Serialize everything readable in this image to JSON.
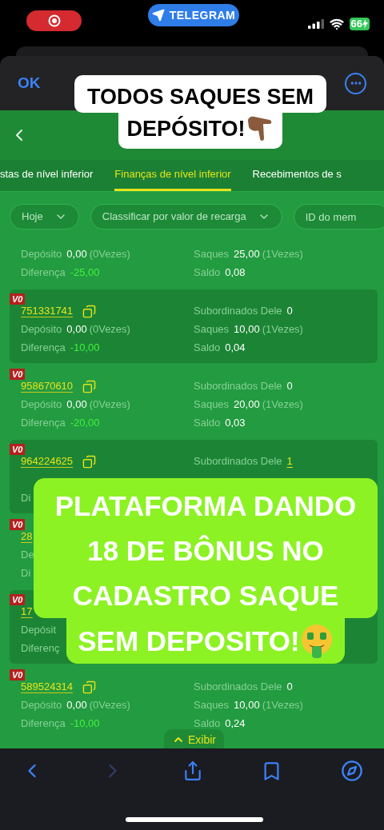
{
  "status_bar": {
    "recording": true,
    "app_pill": "TELEGRAM",
    "battery": "66",
    "charging": true
  },
  "browser": {
    "done": "OK"
  },
  "caption_top": {
    "lines": [
      "TODOS SAQUES SEM",
      "DEPÓSITO!"
    ]
  },
  "tabs": [
    {
      "label": "stas de nível inferior",
      "selected": false
    },
    {
      "label": "Finanças de nível inferior",
      "selected": true
    },
    {
      "label": "Recebimentos de s",
      "selected": false
    }
  ],
  "filters": [
    {
      "kind": "dropdown",
      "label": "Hoje"
    },
    {
      "kind": "dropdown",
      "label": "Classificar por valor de recarga"
    },
    {
      "kind": "field",
      "placeholder": "ID do mem"
    }
  ],
  "rows": [
    {
      "deposit": {
        "label": "Depósito",
        "value": "0,00",
        "count": "(0Vezes)"
      },
      "withdrawals": {
        "label": "Saques",
        "value": "25,00",
        "count": "(1Vezes)"
      },
      "difference": {
        "label": "Diferença",
        "value": "-25,00"
      },
      "balance": {
        "label": "Saldo",
        "value": "0,08"
      }
    },
    {
      "badge": "V0",
      "id": "751331741",
      "copyable": true,
      "subordinates": {
        "label": "Subordinados Dele",
        "value": "0",
        "linked": false
      },
      "deposit": {
        "label": "Depósito",
        "value": "0,00",
        "count": "(0Vezes)"
      },
      "withdrawals": {
        "label": "Saques",
        "value": "10,00",
        "count": "(1Vezes)"
      },
      "difference": {
        "label": "Diferença",
        "value": "-10,00"
      },
      "balance": {
        "label": "Saldo",
        "value": "0,04"
      }
    },
    {
      "badge": "V0",
      "id": "958670610",
      "copyable": true,
      "subordinates": {
        "label": "Subordinados Dele",
        "value": "0",
        "linked": false
      },
      "deposit": {
        "label": "Depósito",
        "value": "0,00",
        "count": "(0Vezes)"
      },
      "withdrawals": {
        "label": "Saques",
        "value": "20,00",
        "count": "(1Vezes)"
      },
      "difference": {
        "label": "Diferença",
        "value": "-20,00"
      },
      "balance": {
        "label": "Saldo",
        "value": "0,03"
      }
    },
    {
      "badge": "V0",
      "id": "964224625",
      "copyable": true,
      "subordinates": {
        "label": "Subordinados Dele",
        "value": "1",
        "linked": true
      },
      "difference": {
        "label": "Di"
      }
    },
    {
      "badge": "V0",
      "id": "28",
      "copyable": false,
      "deposit": {
        "label": "De"
      },
      "difference": {
        "label": "Di"
      }
    },
    {
      "badge": "V0",
      "id": "17",
      "copyable": false,
      "deposit": {
        "label": "Depósit"
      },
      "difference": {
        "label": "Diferenç"
      }
    },
    {
      "badge": "V0",
      "id": "589524314",
      "copyable": true,
      "subordinates": {
        "label": "Subordinados Dele",
        "value": "0",
        "linked": false
      },
      "deposit": {
        "label": "Depósito",
        "value": "0,00",
        "count": "(0Vezes)"
      },
      "withdrawals": {
        "label": "Saques",
        "value": "10,00",
        "count": "(1Vezes)"
      },
      "difference": {
        "label": "Diferença",
        "value": "-10,00"
      },
      "balance": {
        "label": "Saldo",
        "value": "0,24"
      }
    }
  ],
  "caption_main": {
    "lines": [
      "PLATAFORMA DANDO",
      "18 DE BÔNUS NO",
      "CADASTRO SAQUE",
      "SEM DEPOSITO!"
    ]
  },
  "show_button": "Exibir",
  "toolbar": {
    "forward_disabled": true
  }
}
